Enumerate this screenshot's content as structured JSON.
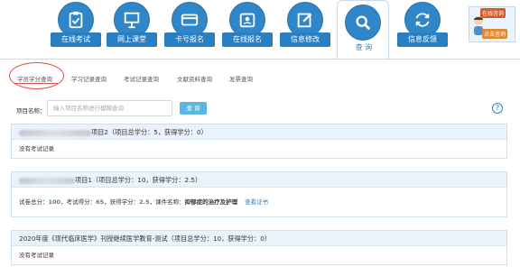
{
  "nav": [
    {
      "label": "在线考试",
      "icon": "clipboard-check-icon"
    },
    {
      "label": "网上课堂",
      "icon": "classroom-board-icon"
    },
    {
      "label": "卡号报名",
      "icon": "card-icon"
    },
    {
      "label": "在线报名",
      "icon": "id-badge-icon"
    },
    {
      "label": "信息修改",
      "icon": "edit-pencil-icon"
    },
    {
      "label": "查 询",
      "icon": "search-icon"
    },
    {
      "label": "信息反馈",
      "icon": "refresh-arrows-icon"
    }
  ],
  "online_consult": {
    "title": "在线咨询",
    "sub": "点击咨询"
  },
  "tabs": [
    "学员学分查询",
    "学习记录查询",
    "考试记录查询",
    "文献资料查询",
    "发票查询"
  ],
  "search": {
    "label": "项目名称：",
    "placeholder": "输入项目名称进行模糊查询",
    "button": "查 询"
  },
  "cards": [
    {
      "title_suffix": "项目2（项目总学分：5，获得学分：0）",
      "body": "没有考试记录"
    },
    {
      "title_suffix": "项目1（项目总学分：10，获得学分：2.5）",
      "detail": {
        "total_label": "试卷总分：",
        "total": "100",
        "score_label": "，考试得分：",
        "score": "65",
        "credit_label": "，获得学分：",
        "credit": "2.5",
        "course_label": "，课件名称：",
        "course": "抑郁症的治疗及护理",
        "link": "查看证书"
      }
    },
    {
      "title": "2020年度《现代临床医学》刊授继续医学教育-测试（项目总学分：10，获得学分：0）",
      "body": "没有考试记录"
    }
  ],
  "colors": {
    "nav_blue": "#2f86c9",
    "accent_red": "#d9534f",
    "green_value": "#3a9c3a"
  }
}
